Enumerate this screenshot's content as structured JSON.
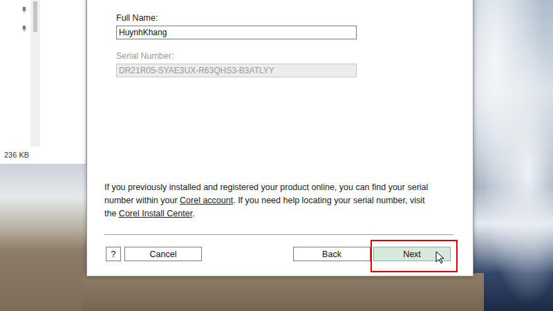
{
  "explorer": {
    "pins": [
      {
        "pinned": true
      },
      {
        "pinned": true
      }
    ],
    "status": "236 KB"
  },
  "dialog": {
    "fields": [
      {
        "label": "Full Name:",
        "value": "HuynhKhang",
        "disabled": false
      },
      {
        "label": "Serial Number:",
        "value": "DR21R05-SYAE3UX-R63QHS3-B3ATLYY",
        "disabled": true
      }
    ],
    "info": [
      {
        "text": "If you previously installed and registered your product online, you can find your serial number within your ",
        "link": false
      },
      {
        "text": "Corel account",
        "link": true
      },
      {
        "text": ". If you need help locating your serial number, visit the ",
        "link": false
      },
      {
        "text": "Corel Install Center",
        "link": true
      },
      {
        "text": ".",
        "link": false
      }
    ],
    "buttons": [
      {
        "label": "?",
        "hovered": false,
        "highlighted": false
      },
      {
        "label": "Cancel",
        "hovered": false,
        "highlighted": false
      },
      {
        "label": "Back",
        "hovered": false,
        "highlighted": false
      },
      {
        "label": "Next",
        "hovered": true,
        "highlighted": true
      }
    ]
  }
}
